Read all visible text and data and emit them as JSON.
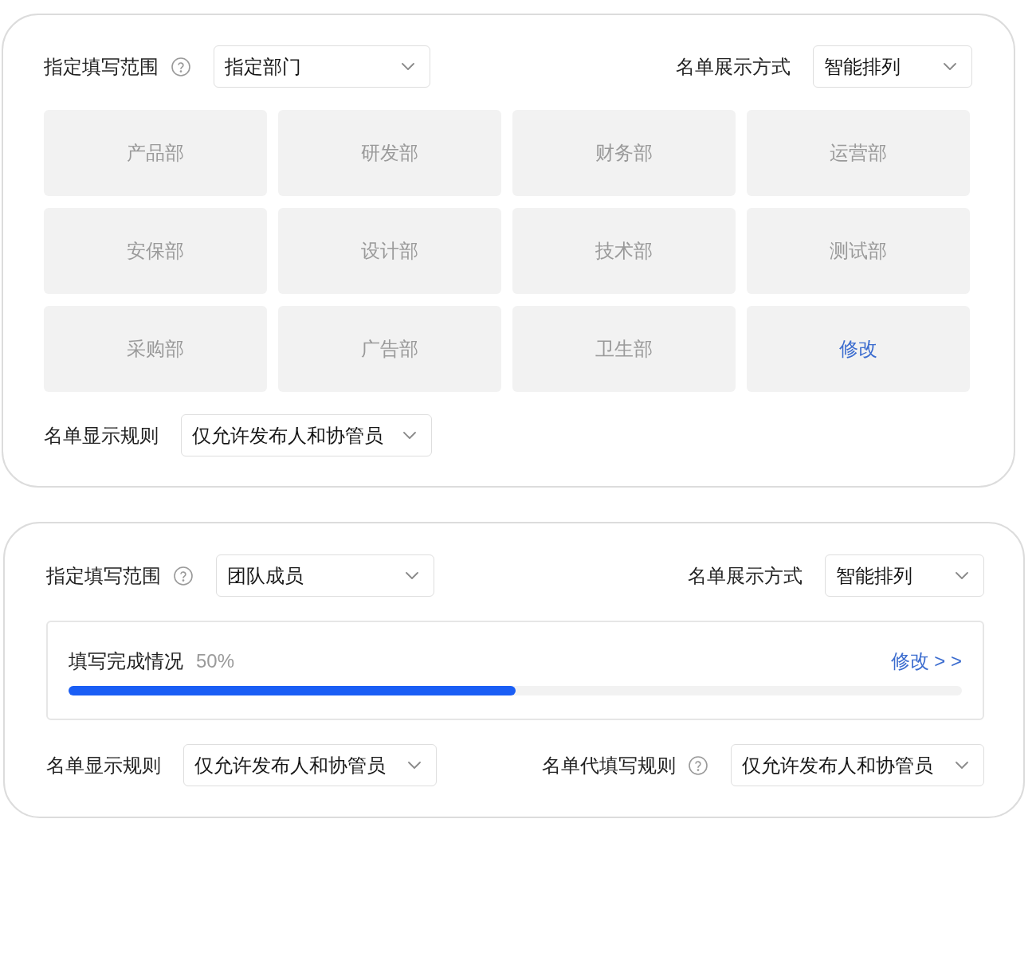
{
  "panels": [
    {
      "scope": {
        "label": "指定填写范围",
        "help": true,
        "value": "指定部门"
      },
      "display_mode": {
        "label": "名单展示方式",
        "value": "智能排列"
      },
      "departments": [
        {
          "label": "产品部",
          "kind": "option"
        },
        {
          "label": "研发部",
          "kind": "option"
        },
        {
          "label": "财务部",
          "kind": "option"
        },
        {
          "label": "运营部",
          "kind": "option"
        },
        {
          "label": "安保部",
          "kind": "option"
        },
        {
          "label": "设计部",
          "kind": "option"
        },
        {
          "label": "技术部",
          "kind": "option"
        },
        {
          "label": "测试部",
          "kind": "option"
        },
        {
          "label": "采购部",
          "kind": "option"
        },
        {
          "label": "广告部",
          "kind": "option"
        },
        {
          "label": "卫生部",
          "kind": "option"
        },
        {
          "label": "修改",
          "kind": "action"
        }
      ],
      "rules": [
        {
          "label": "名单显示规则",
          "value": "仅允许发布人和协管员"
        }
      ]
    },
    {
      "scope": {
        "label": "指定填写范围",
        "help": true,
        "value": "团队成员"
      },
      "display_mode": {
        "label": "名单展示方式",
        "value": "智能排列"
      },
      "progress": {
        "label": "填写完成情况",
        "reading": "50%",
        "level": 0.5,
        "link": "修改 > >"
      },
      "rules": [
        {
          "label": "名单显示规则",
          "value": "仅允许发布人和协管员"
        },
        {
          "label": "名单代填写规则",
          "help": true,
          "value": "仅允许发布人和协管员"
        }
      ]
    }
  ]
}
